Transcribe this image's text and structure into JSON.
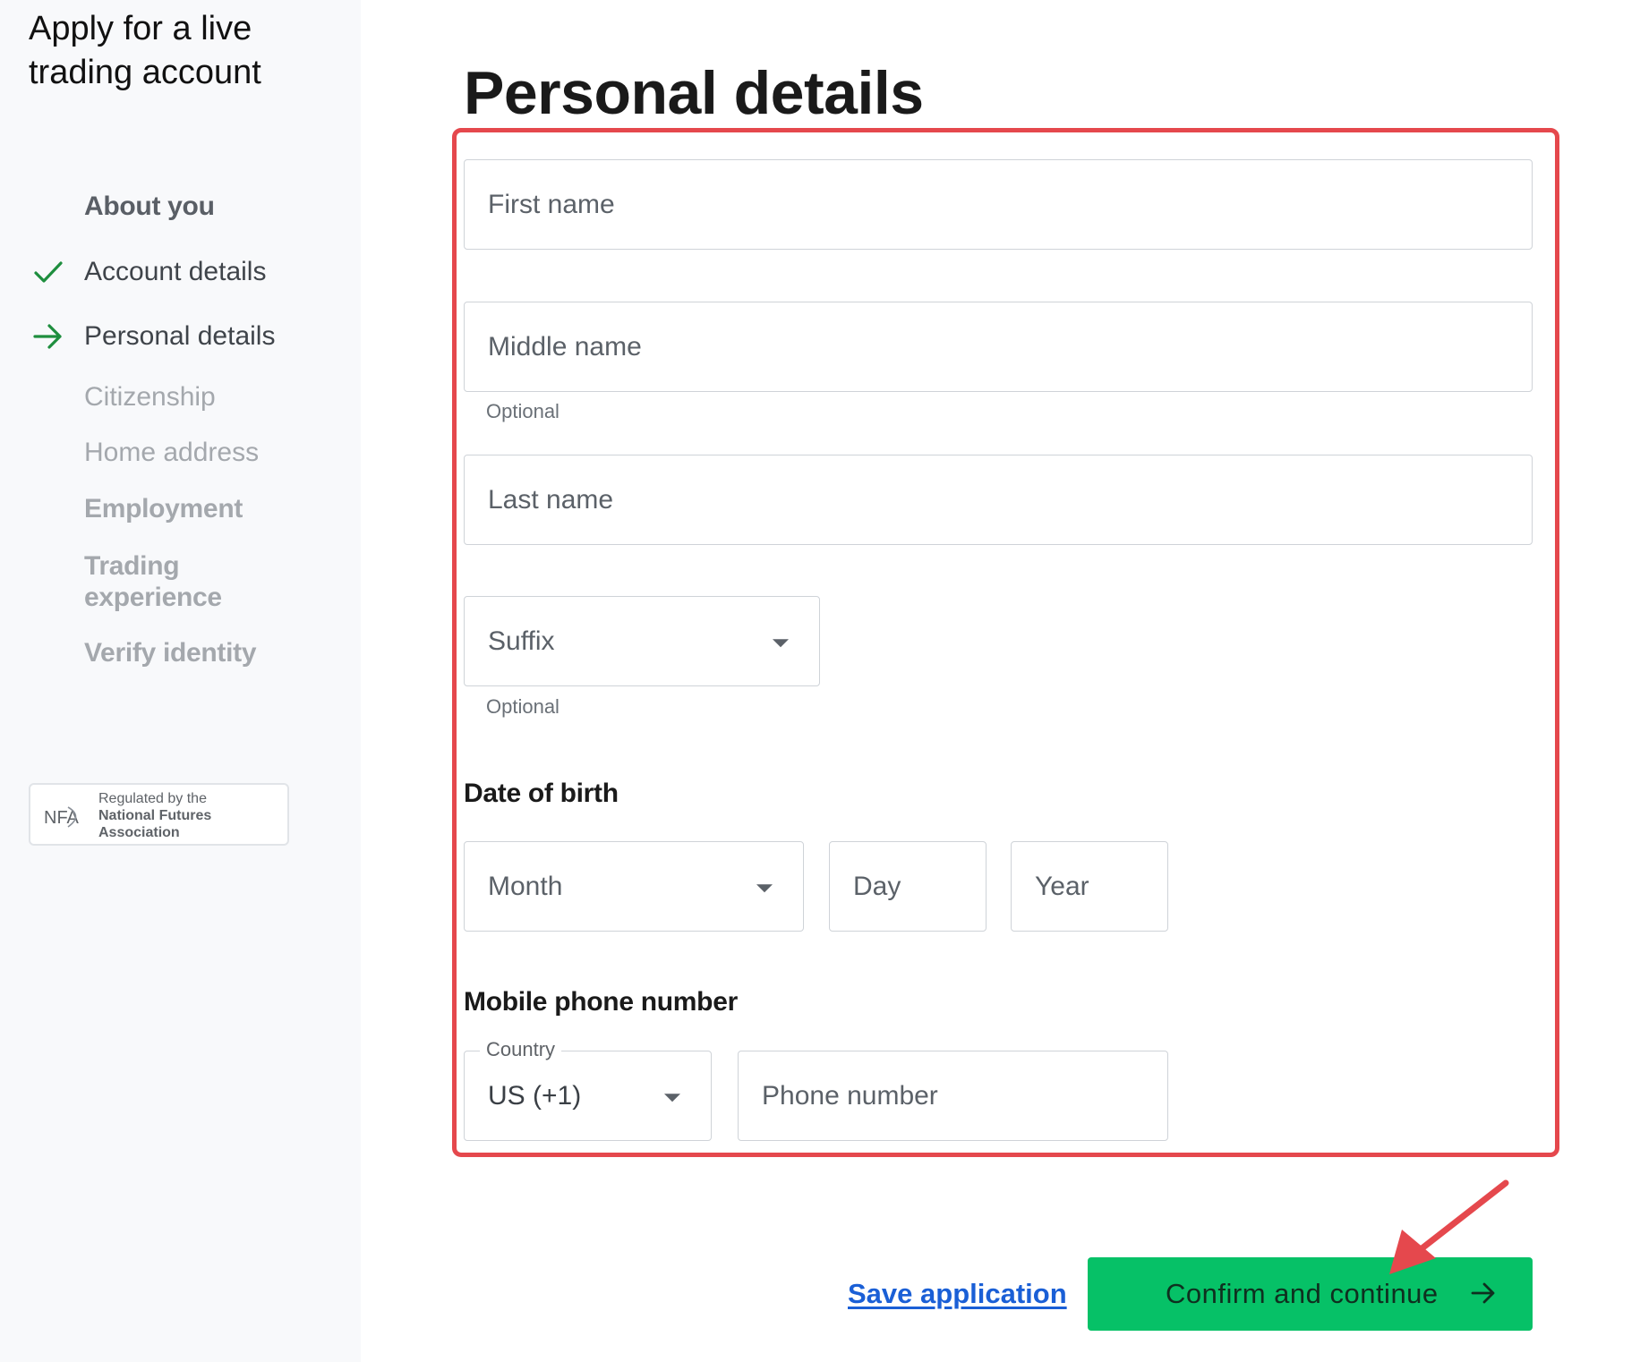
{
  "sidebar": {
    "title": "Apply for a live trading account",
    "section_heading": "About you",
    "steps": [
      {
        "label": "Account details",
        "status": "done",
        "icon": "check-icon"
      },
      {
        "label": "Personal details",
        "status": "current",
        "icon": "arrow-right-icon"
      },
      {
        "label": "Citizenship",
        "status": "todo"
      },
      {
        "label": "Home address",
        "status": "todo"
      },
      {
        "label": "Employment",
        "status": "todo"
      },
      {
        "label": "Trading experience",
        "status": "todo"
      },
      {
        "label": "Verify identity",
        "status": "todo"
      }
    ],
    "badge": {
      "logo_text": "NFA",
      "line1": "Regulated by the",
      "line2": "National Futures",
      "line3": "Association"
    }
  },
  "main": {
    "title": "Personal details",
    "fields": {
      "first_name": {
        "placeholder": "First name"
      },
      "middle_name": {
        "placeholder": "Middle name",
        "helper": "Optional"
      },
      "last_name": {
        "placeholder": "Last name"
      },
      "suffix": {
        "placeholder": "Suffix",
        "helper": "Optional"
      }
    },
    "dob": {
      "label": "Date of birth",
      "month": "Month",
      "day": "Day",
      "year": "Year"
    },
    "phone": {
      "label": "Mobile phone number",
      "country_label": "Country",
      "country_value": "US (+1)",
      "number_placeholder": "Phone number"
    }
  },
  "actions": {
    "save": "Save application",
    "confirm": "Confirm and continue"
  },
  "colors": {
    "accent": "#06c167",
    "link": "#1a5fd6",
    "highlight": "#e5484d",
    "check": "#1e8e3e"
  }
}
